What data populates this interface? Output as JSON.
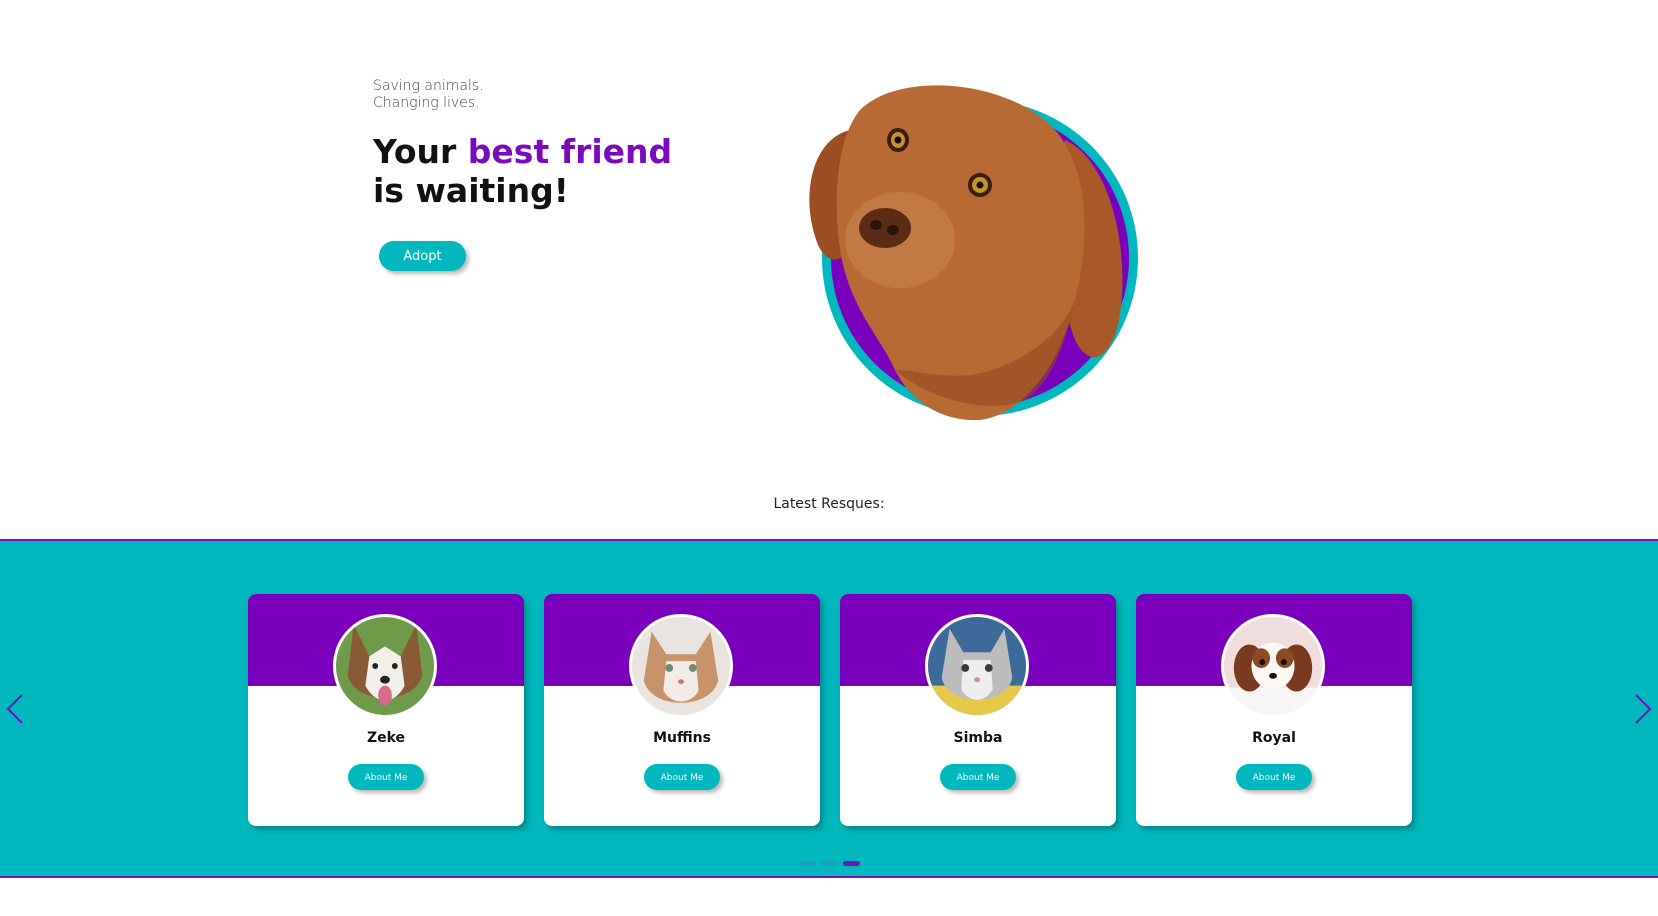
{
  "hero": {
    "tagline_line1": "Saving animals.",
    "tagline_line2": "Changing lives.",
    "title_part1": "Your ",
    "title_accent": "best friend",
    "title_part2": "is waiting!",
    "adopt_label": "Adopt"
  },
  "section": {
    "label": "Latest Resques:"
  },
  "carousel": {
    "pets": [
      {
        "name": "Zeke",
        "button": "About Me",
        "photo": "husky-photo"
      },
      {
        "name": "Muffins",
        "button": "About Me",
        "photo": "kitten-photo"
      },
      {
        "name": "Simba",
        "button": "About Me",
        "photo": "gray-kitten-photo"
      },
      {
        "name": "Royal",
        "button": "About Me",
        "photo": "puppy-photo"
      }
    ],
    "active_page": 3,
    "page_count": 3
  },
  "colors": {
    "accent_purple": "#7a00bd",
    "teal": "#00b8bd",
    "border_purple": "#6a18b8"
  }
}
